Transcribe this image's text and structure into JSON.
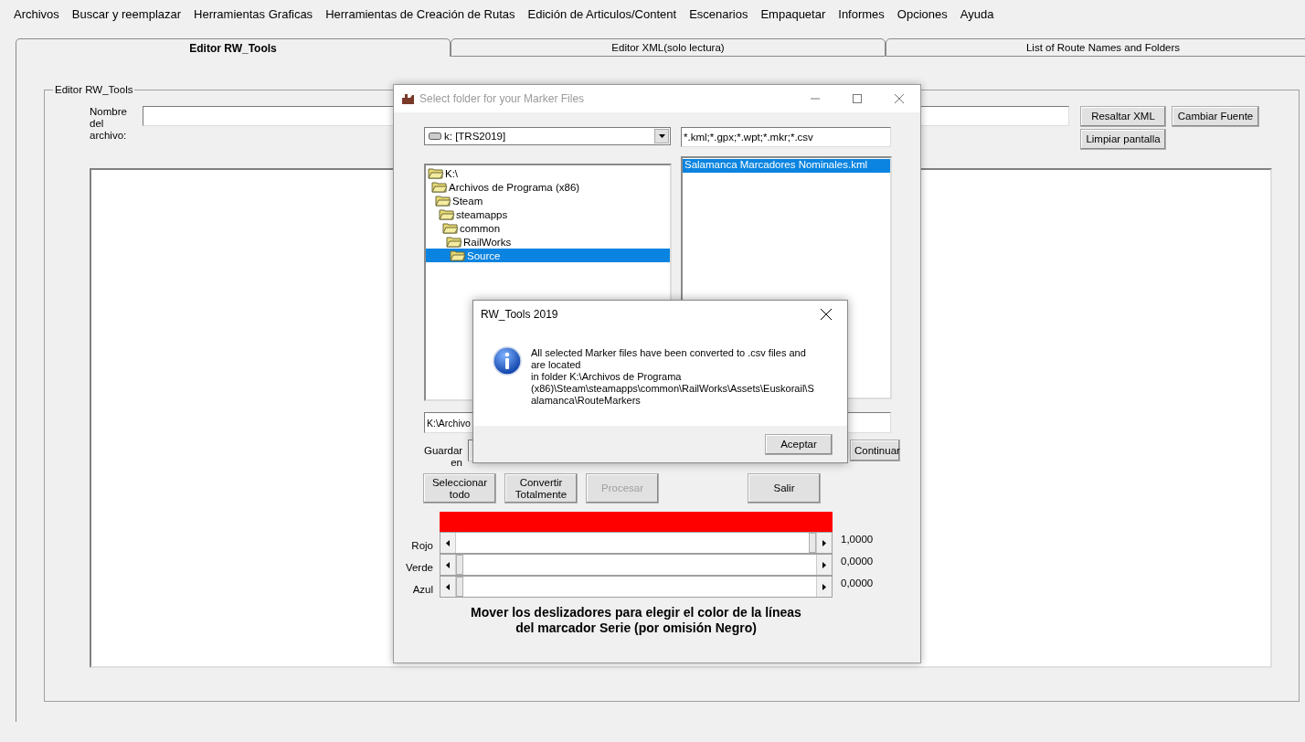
{
  "menu_bar": [
    "Archivos",
    "Buscar y reemplazar",
    "Herramientas Graficas",
    "Herramientas de Creación de Rutas",
    "Edición de Articulos/Content",
    "Escenarios",
    "Empaquetar",
    "Informes",
    "Opciones",
    "Ayuda"
  ],
  "tabs": [
    {
      "label": "Editor RW_Tools",
      "selected": true
    },
    {
      "label": "Editor XML(solo lectura)",
      "selected": false
    },
    {
      "label": "List of Route Names and Folders",
      "selected": false
    }
  ],
  "editor_group": {
    "title": "Editor RW_Tools",
    "file_name_label": "Nombre del archivo:",
    "buttons": [
      "Resaltar XML",
      "Cambiar Fuente",
      "Limpiar pantalla"
    ]
  },
  "folder_dialog": {
    "title": "Select folder for your Marker Files",
    "drive": "k: [TRS2019]",
    "filter": "*.kml;*.gpx;*.wpt;*.mkr;*.csv",
    "tree": [
      {
        "label": "K:\\",
        "selected": false,
        "children": [
          {
            "label": "Archivos de Programa (x86)",
            "selected": false,
            "children": [
              {
                "label": "Steam",
                "selected": false,
                "children": [
                  {
                    "label": "steamapps",
                    "selected": false,
                    "children": [
                      {
                        "label": "common",
                        "selected": false,
                        "children": [
                          {
                            "label": "RailWorks",
                            "selected": false,
                            "children": [
                              {
                                "label": "Source",
                                "selected": true
                              }
                            ]
                          }
                        ]
                      }
                    ]
                  }
                ]
              }
            ]
          }
        ]
      }
    ],
    "files": [
      {
        "label": "Salamanca Marcadores Nominales.kml",
        "selected": true
      }
    ],
    "path": "K:\\Archivo",
    "save_label": "Guardar en",
    "continue_button": "Continuar",
    "buttons": [
      {
        "label": "Seleccionar todo",
        "disabled": false
      },
      {
        "label": "Convertir Totalmente",
        "disabled": false
      },
      {
        "label": "Procesar",
        "disabled": true
      },
      {
        "label": "Salir",
        "disabled": false
      }
    ],
    "sliders": [
      {
        "label": "Rojo",
        "level": 1,
        "reading": "1,0000"
      },
      {
        "label": "Verde",
        "level": 0,
        "reading": "0,0000"
      },
      {
        "label": "Azul",
        "level": 0,
        "reading": "0,0000"
      }
    ],
    "caption": "Mover los deslizadores para elegir el color de la líneas del marcador Serie (por omisión Negro)"
  },
  "message_box": {
    "title": "RW_Tools 2019",
    "message": "All selected Marker files have been converted to .csv files and are located\nin folder K:\\Archivos de Programa (x86)\\Steam\\steamapps\\common\\RailWorks\\Assets\\Euskorail\\Salamanca\\RouteMarkers",
    "button": "Aceptar"
  }
}
